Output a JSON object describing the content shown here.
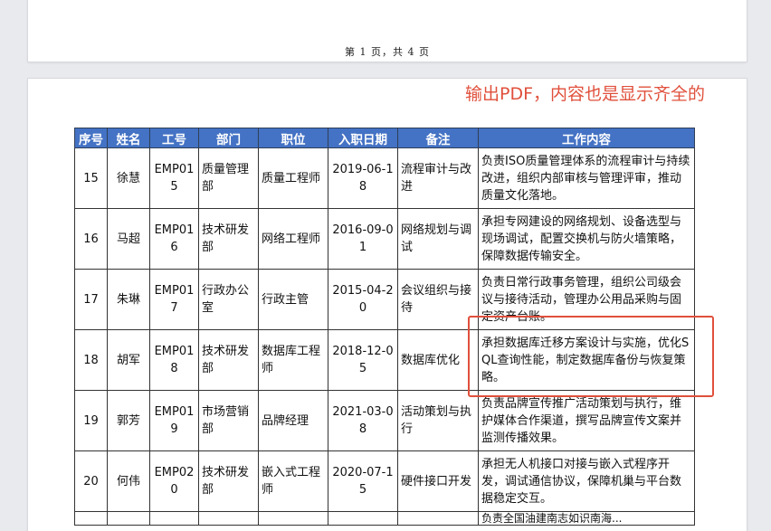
{
  "page1": {
    "footer": "第 1 页，共 4 页"
  },
  "annotation": {
    "text": "输出PDF，内容也是显示齐全的"
  },
  "table": {
    "headers": [
      "序号",
      "姓名",
      "工号",
      "部门",
      "职位",
      "入职日期",
      "备注",
      "工作内容"
    ],
    "rows": [
      [
        "15",
        "徐慧",
        "EMP015",
        "质量管理部",
        "质量工程师",
        "2019-06-18",
        "流程审计与改进",
        "负责ISO质量管理体系的流程审计与持续改进，组织内部审核与管理评审，推动质量文化落地。"
      ],
      [
        "16",
        "马超",
        "EMP016",
        "技术研发部",
        "网络工程师",
        "2016-09-01",
        "网络规划与调试",
        "承担专网建设的网络规划、设备选型与现场调试，配置交换机与防火墙策略，保障数据传输安全。"
      ],
      [
        "17",
        "朱琳",
        "EMP017",
        "行政办公室",
        "行政主管",
        "2015-04-20",
        "会议组织与接待",
        "负责日常行政事务管理，组织公司级会议与接待活动，管理办公用品采购与固定资产台账。"
      ],
      [
        "18",
        "胡军",
        "EMP018",
        "技术研发部",
        "数据库工程师",
        "2018-12-05",
        "数据库优化",
        "承担数据库迁移方案设计与实施，优化SQL查询性能，制定数据库备份与恢复策略。"
      ],
      [
        "19",
        "郭芳",
        "EMP019",
        "市场营销部",
        "品牌经理",
        "2021-03-08",
        "活动策划与执行",
        "负责品牌宣传推广活动策划与执行，维护媒体合作渠道，撰写品牌宣传文案并监测传播效果。"
      ],
      [
        "20",
        "何伟",
        "EMP020",
        "技术研发部",
        "嵌入式工程师",
        "2020-07-15",
        "硬件接口开发",
        "承担无人机接口对接与嵌入式程序开发，调试通信协议，保障机巢与平台数据稳定交互。"
      ]
    ],
    "partial_row_text": "负责全国油建南志如识南海..."
  }
}
